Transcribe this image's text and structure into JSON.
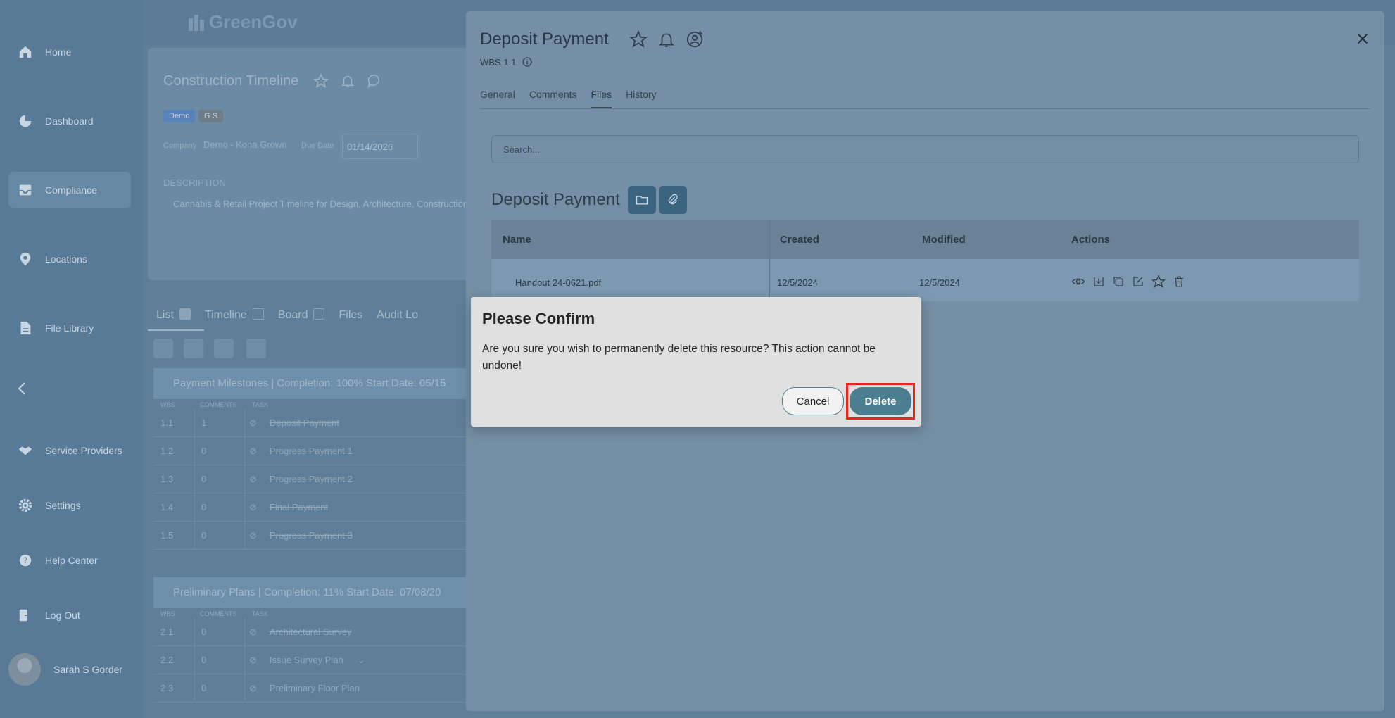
{
  "app": {
    "brand": "GreenGov"
  },
  "sidebar": {
    "items": [
      {
        "label": "Home",
        "icon": "home-icon"
      },
      {
        "label": "Dashboard",
        "icon": "pie-chart-icon"
      },
      {
        "label": "Compliance",
        "icon": "inbox-icon",
        "active": true
      },
      {
        "label": "Locations",
        "icon": "map-pin-icon"
      },
      {
        "label": "File Library",
        "icon": "file-icon"
      },
      {
        "label": "Service Providers",
        "icon": "handshake-icon"
      },
      {
        "label": "Settings",
        "icon": "gear-icon"
      },
      {
        "label": "Help Center",
        "icon": "help-icon"
      },
      {
        "label": "Log Out",
        "icon": "logout-icon"
      }
    ],
    "user_name": "Sarah S Gorder"
  },
  "project": {
    "title": "Construction Timeline",
    "tags": [
      "Demo",
      "G S"
    ],
    "company_label": "Company",
    "company_value": "Demo - Kona Grown",
    "due_label": "Due Date",
    "due_value": "01/14/2026",
    "description_label": "DESCRIPTION",
    "description": "Cannabis & Retail Project Timeline for Design, Architecture, Construction",
    "view_tabs": [
      "List",
      "Timeline",
      "Board",
      "Files",
      "Audit Lo"
    ],
    "sections": [
      {
        "header": "Payment Milestones  | Completion: 100%  Start Date: 05/15",
        "cols": [
          "WBS",
          "COMMENTS",
          "TASK"
        ],
        "rows": [
          {
            "wbs": "1.1",
            "comments": "1",
            "task": "Deposit Payment"
          },
          {
            "wbs": "1.2",
            "comments": "0",
            "task": "Progress Payment 1"
          },
          {
            "wbs": "1.3",
            "comments": "0",
            "task": "Progress Payment 2"
          },
          {
            "wbs": "1.4",
            "comments": "0",
            "task": "Final Payment"
          },
          {
            "wbs": "1.5",
            "comments": "0",
            "task": "Progress Payment 3"
          }
        ]
      },
      {
        "header": "Preliminary Plans  | Completion: 11%  Start Date: 07/08/20",
        "cols": [
          "WBS",
          "COMMENTS",
          "TASK"
        ],
        "rows": [
          {
            "wbs": "2.1",
            "comments": "0",
            "task": "Architectural Survey"
          },
          {
            "wbs": "2.2",
            "comments": "0",
            "task": "Issue Survey Plan"
          },
          {
            "wbs": "2.3",
            "comments": "0",
            "task": "Preliminary Floor Plan"
          }
        ]
      }
    ]
  },
  "panel": {
    "title": "Deposit Payment",
    "wbs": "WBS 1.1",
    "tabs": [
      "General",
      "Comments",
      "Files",
      "History"
    ],
    "active_tab": "Files",
    "search_placeholder": "Search...",
    "folder_title": "Deposit Payment",
    "table": {
      "headers": [
        "Name",
        "Created",
        "Modified",
        "Actions"
      ],
      "rows": [
        {
          "name": "Handout 24-0621.pdf",
          "created": "12/5/2024",
          "modified": "12/5/2024"
        }
      ]
    }
  },
  "modal": {
    "title": "Please Confirm",
    "body": "Are you sure you wish to permanently delete this resource? This action cannot be undone!",
    "cancel_label": "Cancel",
    "delete_label": "Delete"
  },
  "colors": {
    "accent": "#4b7e8e",
    "highlight": "#e8261b"
  }
}
